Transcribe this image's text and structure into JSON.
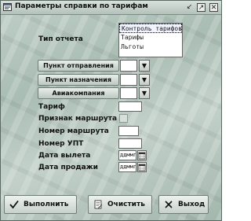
{
  "window": {
    "title": "Параметры справки по тарифам",
    "min_glyph": "↙",
    "max_glyph": "↗",
    "close_glyph": "✕"
  },
  "report_type": {
    "label": "Тип отчета",
    "options": [
      "Контроль тарифов",
      "Тарифы",
      "Льготы"
    ],
    "selected_index": 0
  },
  "filters": {
    "departure_button": "Пункт отправления",
    "destination_button": "Пункт назначения",
    "airline_button": "Авиакомпания",
    "dropdown_arrow": "▼"
  },
  "fields": {
    "tariff_label": "Тариф",
    "route_flag_label": "Признак маршрута",
    "route_number_label": "Номер маршрута",
    "upt_number_label": "Номер УПТ",
    "departure_date_label": "Дата вылета",
    "departure_date_value": "ддммгг",
    "sale_date_label": "Дата продажи",
    "sale_date_value": "ддммгг"
  },
  "actions": {
    "execute": "Выполнить",
    "clear": "Очистить",
    "exit": "Выход"
  }
}
